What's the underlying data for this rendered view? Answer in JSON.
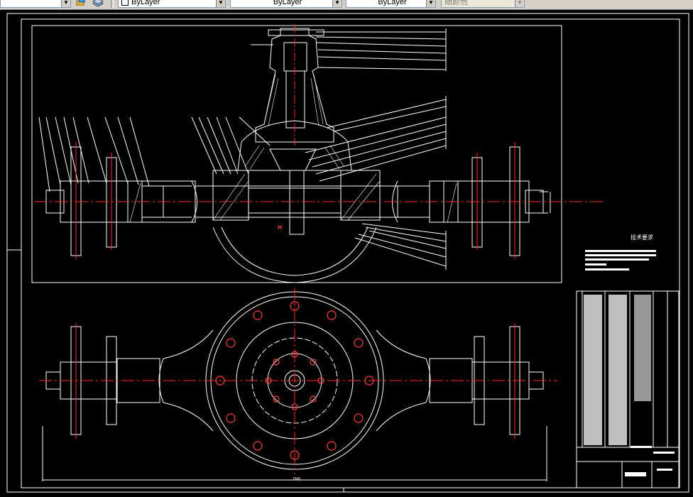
{
  "toolbar": {
    "color_combo": "ByLayer",
    "linetype_combo": "ByLayer",
    "lineweight_combo": "ByLayer",
    "plotstyle_combo": "随颜色"
  },
  "drawing": {
    "tech_requirements_title": "技术要求",
    "bottom_dim": "1840"
  },
  "colors": {
    "background": "#000000",
    "lines": "#ffffff",
    "centerline": "#ff2a2a",
    "toolbar": "#d4d0c8"
  }
}
